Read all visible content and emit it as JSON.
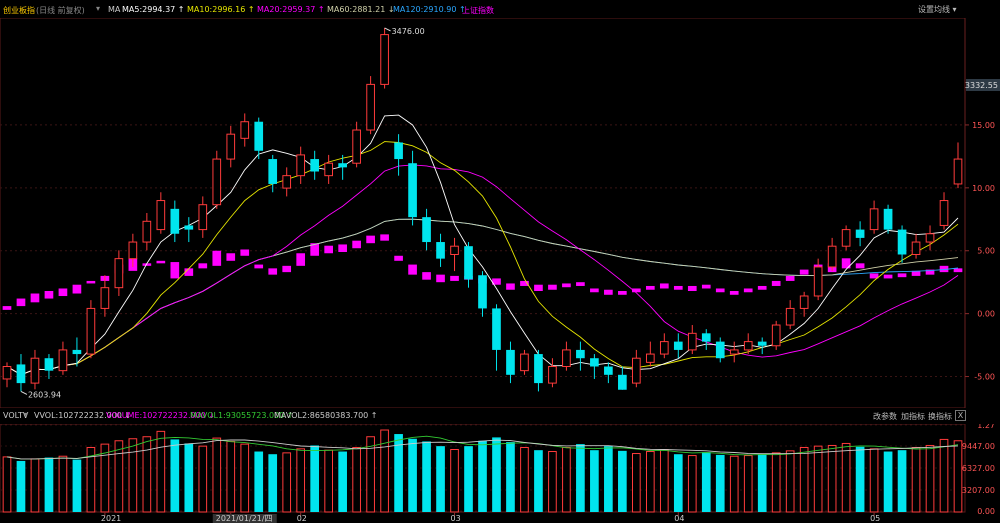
{
  "header": {
    "title": "创业板指",
    "subtitle": "(日线 前复权)",
    "ma_label": "MA",
    "ma5": "MA5:2994.37 ↑",
    "ma10": "MA10:2996.16 ↑",
    "ma20": "MA20:2959.37 ↑",
    "ma60": "MA60:2881.21 ↓",
    "ma120": "MA120:2910.90 ↑",
    "overlay": "上证指数",
    "settings": "设置均线 ▾"
  },
  "volume_bar": {
    "name": "VOLTV",
    "vvol": "VVOL:102722232.000 ↓",
    "volume": "VOLUME:102722232.000 ↓",
    "mavol1": "MAVOL1:93055723.000 ↑",
    "mavol2": "MAVOL2:86580383.700 ↑",
    "btn_params": "改参数",
    "btn_add": "加指标",
    "btn_switch": "换指标",
    "close": "X"
  },
  "colors": {
    "up": "#ff3b3b",
    "down": "#00e5ee",
    "overlay": "#ff00ff",
    "ma5": "#ffffff",
    "ma10": "#e6e600",
    "ma20": "#ff00ff",
    "ma60": "#cfcfa8",
    "ma120": "#2aa7ff",
    "price_box": "#2e3a45"
  },
  "chart_data": {
    "type": "candlestick",
    "main": {
      "max_label": "3476.00",
      "min_label": "2603.94",
      "current_price": "3332.55",
      "right_ticks": [
        "15.00",
        "10.00",
        "5.00",
        "0.00",
        "-5.00"
      ],
      "right_tick_values": [
        15,
        10,
        5,
        0,
        -5
      ],
      "price_range": [
        2560,
        3500
      ],
      "pct_range": [
        -7.5,
        23.5
      ]
    },
    "volume": {
      "ticks": [
        "1.27",
        "9447.00",
        "6327.00",
        "3207.00",
        "0.00"
      ],
      "max": 12.5
    },
    "x_labels": [
      {
        "label": "2021",
        "i": 7
      },
      {
        "label": "2021/01/21/四",
        "i": 16
      },
      {
        "label": "02",
        "i": 21
      },
      {
        "label": "03",
        "i": 32
      },
      {
        "label": "04",
        "i": 48
      },
      {
        "label": "05",
        "i": 62
      }
    ],
    "candles": [
      [
        2630,
        2660,
        2610,
        2670
      ],
      [
        2665,
        2620,
        2600,
        2690
      ],
      [
        2620,
        2680,
        2605,
        2700
      ],
      [
        2680,
        2650,
        2630,
        2690
      ],
      [
        2650,
        2700,
        2640,
        2720
      ],
      [
        2700,
        2690,
        2660,
        2730
      ],
      [
        2690,
        2800,
        2680,
        2820
      ],
      [
        2800,
        2850,
        2780,
        2880
      ],
      [
        2850,
        2920,
        2830,
        2940
      ],
      [
        2920,
        2960,
        2900,
        2980
      ],
      [
        2960,
        3010,
        2940,
        3030
      ],
      [
        2990,
        3060,
        2980,
        3080
      ],
      [
        3040,
        2980,
        2960,
        3060
      ],
      [
        3000,
        2990,
        2960,
        3020
      ],
      [
        2990,
        3050,
        2970,
        3070
      ],
      [
        3050,
        3160,
        3040,
        3180
      ],
      [
        3160,
        3220,
        3140,
        3240
      ],
      [
        3210,
        3250,
        3190,
        3270
      ],
      [
        3250,
        3180,
        3160,
        3260
      ],
      [
        3160,
        3100,
        3080,
        3170
      ],
      [
        3090,
        3120,
        3070,
        3140
      ],
      [
        3120,
        3170,
        3100,
        3190
      ],
      [
        3160,
        3130,
        3110,
        3180
      ],
      [
        3120,
        3150,
        3100,
        3170
      ],
      [
        3150,
        3140,
        3110,
        3170
      ],
      [
        3150,
        3230,
        3140,
        3250
      ],
      [
        3230,
        3340,
        3220,
        3360
      ],
      [
        3340,
        3460,
        3330,
        3476
      ],
      [
        3200,
        3160,
        3120,
        3220
      ],
      [
        3150,
        3020,
        3000,
        3180
      ],
      [
        3020,
        2960,
        2940,
        3040
      ],
      [
        2960,
        2920,
        2900,
        2980
      ],
      [
        2930,
        2950,
        2890,
        2970
      ],
      [
        2950,
        2870,
        2850,
        2960
      ],
      [
        2880,
        2800,
        2780,
        2890
      ],
      [
        2800,
        2700,
        2650,
        2810
      ],
      [
        2700,
        2640,
        2620,
        2720
      ],
      [
        2650,
        2690,
        2640,
        2700
      ],
      [
        2690,
        2620,
        2600,
        2700
      ],
      [
        2620,
        2660,
        2610,
        2680
      ],
      [
        2660,
        2700,
        2650,
        2720
      ],
      [
        2700,
        2680,
        2650,
        2720
      ],
      [
        2680,
        2660,
        2630,
        2690
      ],
      [
        2660,
        2640,
        2620,
        2670
      ],
      [
        2640,
        2604,
        2604,
        2660
      ],
      [
        2620,
        2680,
        2610,
        2700
      ],
      [
        2670,
        2690,
        2660,
        2720
      ],
      [
        2690,
        2720,
        2680,
        2740
      ],
      [
        2720,
        2700,
        2680,
        2740
      ],
      [
        2700,
        2740,
        2690,
        2760
      ],
      [
        2740,
        2720,
        2700,
        2750
      ],
      [
        2720,
        2680,
        2670,
        2730
      ],
      [
        2690,
        2700,
        2670,
        2720
      ],
      [
        2700,
        2720,
        2690,
        2740
      ],
      [
        2720,
        2710,
        2690,
        2730
      ],
      [
        2710,
        2760,
        2700,
        2770
      ],
      [
        2760,
        2800,
        2750,
        2820
      ],
      [
        2800,
        2830,
        2780,
        2840
      ],
      [
        2830,
        2900,
        2820,
        2920
      ],
      [
        2900,
        2950,
        2890,
        2970
      ],
      [
        2950,
        2990,
        2940,
        3000
      ],
      [
        2990,
        2970,
        2950,
        3010
      ],
      [
        2990,
        3040,
        2980,
        3060
      ],
      [
        3040,
        2990,
        2980,
        3050
      ],
      [
        2990,
        2930,
        2910,
        3000
      ],
      [
        2930,
        2960,
        2920,
        2980
      ],
      [
        2960,
        2980,
        2940,
        3000
      ],
      [
        3000,
        3060,
        2990,
        3080
      ],
      [
        3100,
        3160,
        3090,
        3200
      ]
    ],
    "overlay_candles": [
      [
        0.3,
        0.6
      ],
      [
        0.6,
        1.2
      ],
      [
        0.9,
        1.6
      ],
      [
        1.2,
        1.8
      ],
      [
        1.4,
        2.0
      ],
      [
        1.6,
        2.3
      ],
      [
        2.4,
        2.6
      ],
      [
        2.6,
        3.0
      ],
      [
        3.2,
        3.9
      ],
      [
        3.4,
        4.4
      ],
      [
        3.8,
        4.0
      ],
      [
        4.0,
        4.2
      ],
      [
        2.8,
        4.1
      ],
      [
        3.0,
        3.6
      ],
      [
        3.6,
        4.0
      ],
      [
        3.8,
        5.0
      ],
      [
        4.2,
        4.8
      ],
      [
        4.6,
        5.1
      ],
      [
        3.6,
        3.9
      ],
      [
        3.1,
        3.6
      ],
      [
        3.3,
        3.8
      ],
      [
        3.8,
        4.8
      ],
      [
        4.6,
        5.6
      ],
      [
        4.8,
        5.4
      ],
      [
        4.9,
        5.5
      ],
      [
        5.2,
        5.8
      ],
      [
        5.6,
        6.2
      ],
      [
        5.8,
        6.3
      ],
      [
        4.2,
        4.6
      ],
      [
        3.1,
        3.9
      ],
      [
        2.7,
        3.3
      ],
      [
        2.5,
        3.1
      ],
      [
        2.6,
        3.0
      ],
      [
        2.7,
        3.0
      ],
      [
        2.4,
        2.8
      ],
      [
        2.3,
        2.8
      ],
      [
        1.9,
        2.4
      ],
      [
        2.2,
        2.6
      ],
      [
        1.8,
        2.3
      ],
      [
        1.9,
        2.3
      ],
      [
        2.1,
        2.4
      ],
      [
        2.2,
        2.5
      ],
      [
        1.7,
        2.0
      ],
      [
        1.5,
        1.9
      ],
      [
        1.5,
        1.8
      ],
      [
        1.7,
        2.0
      ],
      [
        1.9,
        2.2
      ],
      [
        2.0,
        2.4
      ],
      [
        1.9,
        2.2
      ],
      [
        1.8,
        2.2
      ],
      [
        2.0,
        2.3
      ],
      [
        1.7,
        2.0
      ],
      [
        1.5,
        1.8
      ],
      [
        1.7,
        2.0
      ],
      [
        1.9,
        2.2
      ],
      [
        2.2,
        2.6
      ],
      [
        2.6,
        3.0
      ],
      [
        3.1,
        3.5
      ],
      [
        3.2,
        3.9
      ],
      [
        3.3,
        4.0
      ],
      [
        3.6,
        4.4
      ],
      [
        3.6,
        4.0
      ],
      [
        2.8,
        3.2
      ],
      [
        2.8,
        3.1
      ],
      [
        2.9,
        3.2
      ],
      [
        3.0,
        3.4
      ],
      [
        3.1,
        3.5
      ],
      [
        3.3,
        3.8
      ],
      [
        3.3,
        3.6
      ]
    ],
    "volumes": [
      8.2,
      7.6,
      7.9,
      8.1,
      8.3,
      7.8,
      9.6,
      10.1,
      10.6,
      10.9,
      11.2,
      12.0,
      10.8,
      10.2,
      9.8,
      11.0,
      10.5,
      10.1,
      9.0,
      8.6,
      8.8,
      9.4,
      9.9,
      9.2,
      9.0,
      9.6,
      11.2,
      12.2,
      11.6,
      10.9,
      10.5,
      9.8,
      9.3,
      9.8,
      10.6,
      11.1,
      10.4,
      9.6,
      9.2,
      9.0,
      9.6,
      10.1,
      9.2,
      9.8,
      9.1,
      8.7,
      9.0,
      9.3,
      8.6,
      8.4,
      8.9,
      8.5,
      8.3,
      8.4,
      8.6,
      8.8,
      9.1,
      9.6,
      9.8,
      9.9,
      10.2,
      9.7,
      9.4,
      9.0,
      9.2,
      9.6,
      9.9,
      10.8,
      10.6
    ]
  }
}
